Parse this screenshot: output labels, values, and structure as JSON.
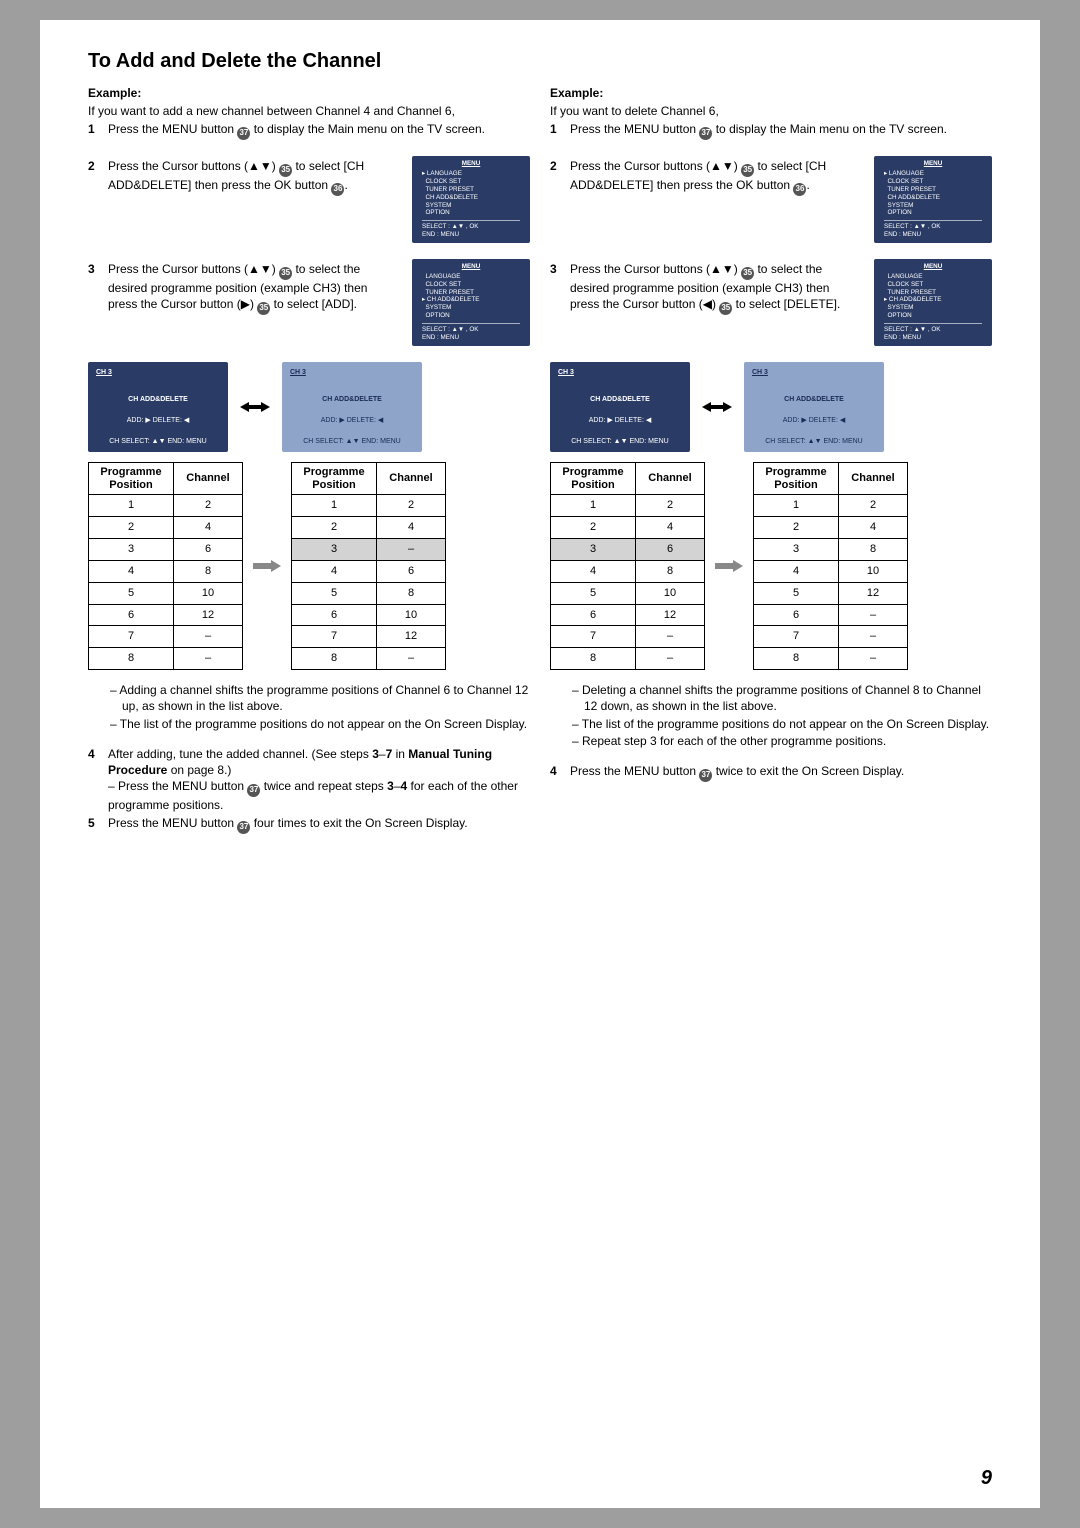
{
  "title": "To Add and Delete the Channel",
  "page_number": "9",
  "left": {
    "example_label": "Example:",
    "intro": "If you want to add a new channel between Channel 4 and Channel 6,",
    "step1": "Press the MENU button 37 to display the Main menu on the TV screen.",
    "step2": "Press the Cursor buttons (▲▼) 35 to select [CH ADD&DELETE] then press the OK button 36.",
    "step3": "Press the Cursor buttons (▲▼) 35 to select the desired programme position (example CH3) then press the Cursor button (▶) 35 to select [ADD].",
    "ch_header": "CH 3",
    "ch_mid": "CH ADD&DELETE",
    "ch_foot_a": "ADD: ▶   DELETE: ◀",
    "ch_foot_b": "CH SELECT: ▲▼   END: MENU",
    "notes": [
      "– Adding a channel shifts the programme positions of Channel 6 to Channel 12 up, as shown in the list above.",
      "– The list of the programme positions do not appear on the On Screen Display."
    ],
    "step4": "After adding, tune the added channel. (See steps 3–7 in Manual Tuning Procedure on page 8.)",
    "step4_sub": "– Press the MENU button 37 twice and repeat steps 3–4 for each of the other programme positions.",
    "step5": "Press the MENU button 37 four times to exit the On Screen Display."
  },
  "right": {
    "example_label": "Example:",
    "intro": "If you want to delete Channel 6,",
    "step1": "Press the MENU button 37 to display the Main menu on the TV screen.",
    "step2": "Press the Cursor buttons (▲▼) 35 to select [CH ADD&DELETE] then press the OK button 36.",
    "step3": "Press the Cursor buttons (▲▼) 35 to select the desired programme position (example CH3) then press the Cursor button (◀) 35 to select [DELETE].",
    "ch_header": "CH 3",
    "ch_mid": "CH ADD&DELETE",
    "ch_foot_a": "ADD: ▶   DELETE: ◀",
    "ch_foot_b": "CH SELECT: ▲▼   END: MENU",
    "notes": [
      "– Deleting a channel shifts the programme positions of Channel 8 to Channel 12 down, as shown in the list above.",
      "– The list of the programme positions do not appear on the On Screen Display.",
      "– Repeat step 3 for each of the other programme positions."
    ],
    "step4": "Press the MENU button 37 twice to exit the On Screen Display."
  },
  "menu": {
    "title": "MENU",
    "items": [
      "▸ LANGUAGE",
      "  CLOCK SET",
      "  TUNER PRESET",
      "  CH ADD&DELETE",
      "  SYSTEM",
      "  OPTION"
    ],
    "items2": [
      "  LANGUAGE",
      "  CLOCK SET",
      "  TUNER PRESET",
      "▸ CH ADD&DELETE",
      "  SYSTEM",
      "  OPTION"
    ],
    "foot_l": "SELECT : ▲▼ , OK",
    "foot_r": "END       : MENU"
  },
  "table_headers": {
    "pp": "Programme Position",
    "ch": "Channel"
  },
  "tables": {
    "left_before": [
      [
        "1",
        "2"
      ],
      [
        "2",
        "4"
      ],
      [
        "3",
        "6"
      ],
      [
        "4",
        "8"
      ],
      [
        "5",
        "10"
      ],
      [
        "6",
        "12"
      ],
      [
        "7",
        "–"
      ],
      [
        "8",
        "–"
      ]
    ],
    "left_after": [
      [
        "1",
        "2"
      ],
      [
        "2",
        "4"
      ],
      [
        "3",
        "–"
      ],
      [
        "4",
        "6"
      ],
      [
        "5",
        "8"
      ],
      [
        "6",
        "10"
      ],
      [
        "7",
        "12"
      ],
      [
        "8",
        "–"
      ]
    ],
    "right_before": [
      [
        "1",
        "2"
      ],
      [
        "2",
        "4"
      ],
      [
        "3",
        "6"
      ],
      [
        "4",
        "8"
      ],
      [
        "5",
        "10"
      ],
      [
        "6",
        "12"
      ],
      [
        "7",
        "–"
      ],
      [
        "8",
        "–"
      ]
    ],
    "right_after": [
      [
        "1",
        "2"
      ],
      [
        "2",
        "4"
      ],
      [
        "3",
        "8"
      ],
      [
        "4",
        "10"
      ],
      [
        "5",
        "12"
      ],
      [
        "6",
        "–"
      ],
      [
        "7",
        "–"
      ],
      [
        "8",
        "–"
      ]
    ]
  },
  "highlight_row": 2
}
